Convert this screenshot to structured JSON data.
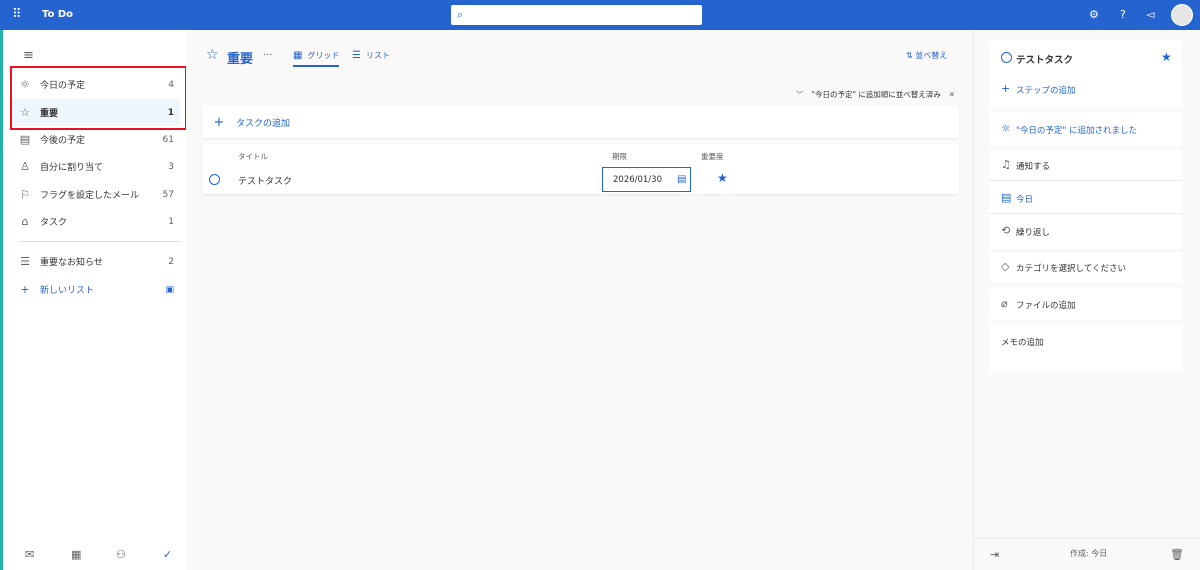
{
  "app": {
    "title": "To Do"
  },
  "topbar": {
    "search_placeholder": "",
    "icons": [
      "waffle-icon",
      "search-icon",
      "settings-icon",
      "help-icon",
      "megaphone-icon",
      "avatar"
    ]
  },
  "sidebar": {
    "items": [
      {
        "icon": "sun-icon",
        "label": "今日の予定",
        "count": "4"
      },
      {
        "icon": "star-icon",
        "label": "重要",
        "count": "1"
      },
      {
        "icon": "calendar-icon",
        "label": "今後の予定",
        "count": "61"
      },
      {
        "icon": "person-icon",
        "label": "自分に割り当て",
        "count": "3"
      },
      {
        "icon": "flag-icon",
        "label": "フラグを設定したメール",
        "count": "57"
      },
      {
        "icon": "home-icon",
        "label": "タスク",
        "count": "1"
      },
      {
        "icon": "list-icon",
        "label": "重要なお知らせ",
        "count": "2"
      }
    ],
    "new_list_label": "新しいリスト",
    "active_index": 1
  },
  "main": {
    "title": "重要",
    "more": "···",
    "tabs": [
      {
        "label": "グリッド",
        "icon": "grid-icon"
      },
      {
        "label": "リスト",
        "icon": "list-view-icon"
      }
    ],
    "sort_label": "並べ替え",
    "sort_note": "\"今日の予定\" に追加順に並べ替え済み",
    "add_task_label": "タスクの追加",
    "columns": {
      "title": "タイトル",
      "due": "期限",
      "importance": "重要度"
    },
    "tasks": [
      {
        "title": "テストタスク",
        "due": "2026/01/30",
        "important": true
      }
    ]
  },
  "details": {
    "task_title": "テストタスク",
    "add_step": "ステップの追加",
    "added_to_my_day": "\"今日の予定\" に追加されました",
    "remind_me": "通知する",
    "due_today": "今日",
    "repeat": "繰り返し",
    "pick_category": "カテゴリを選択してください",
    "add_file": "ファイルの追加",
    "add_note": "メモの追加",
    "created": "作成: 今日"
  },
  "colors": {
    "brand": "#2564cf",
    "highlight_box": "#e81123"
  }
}
